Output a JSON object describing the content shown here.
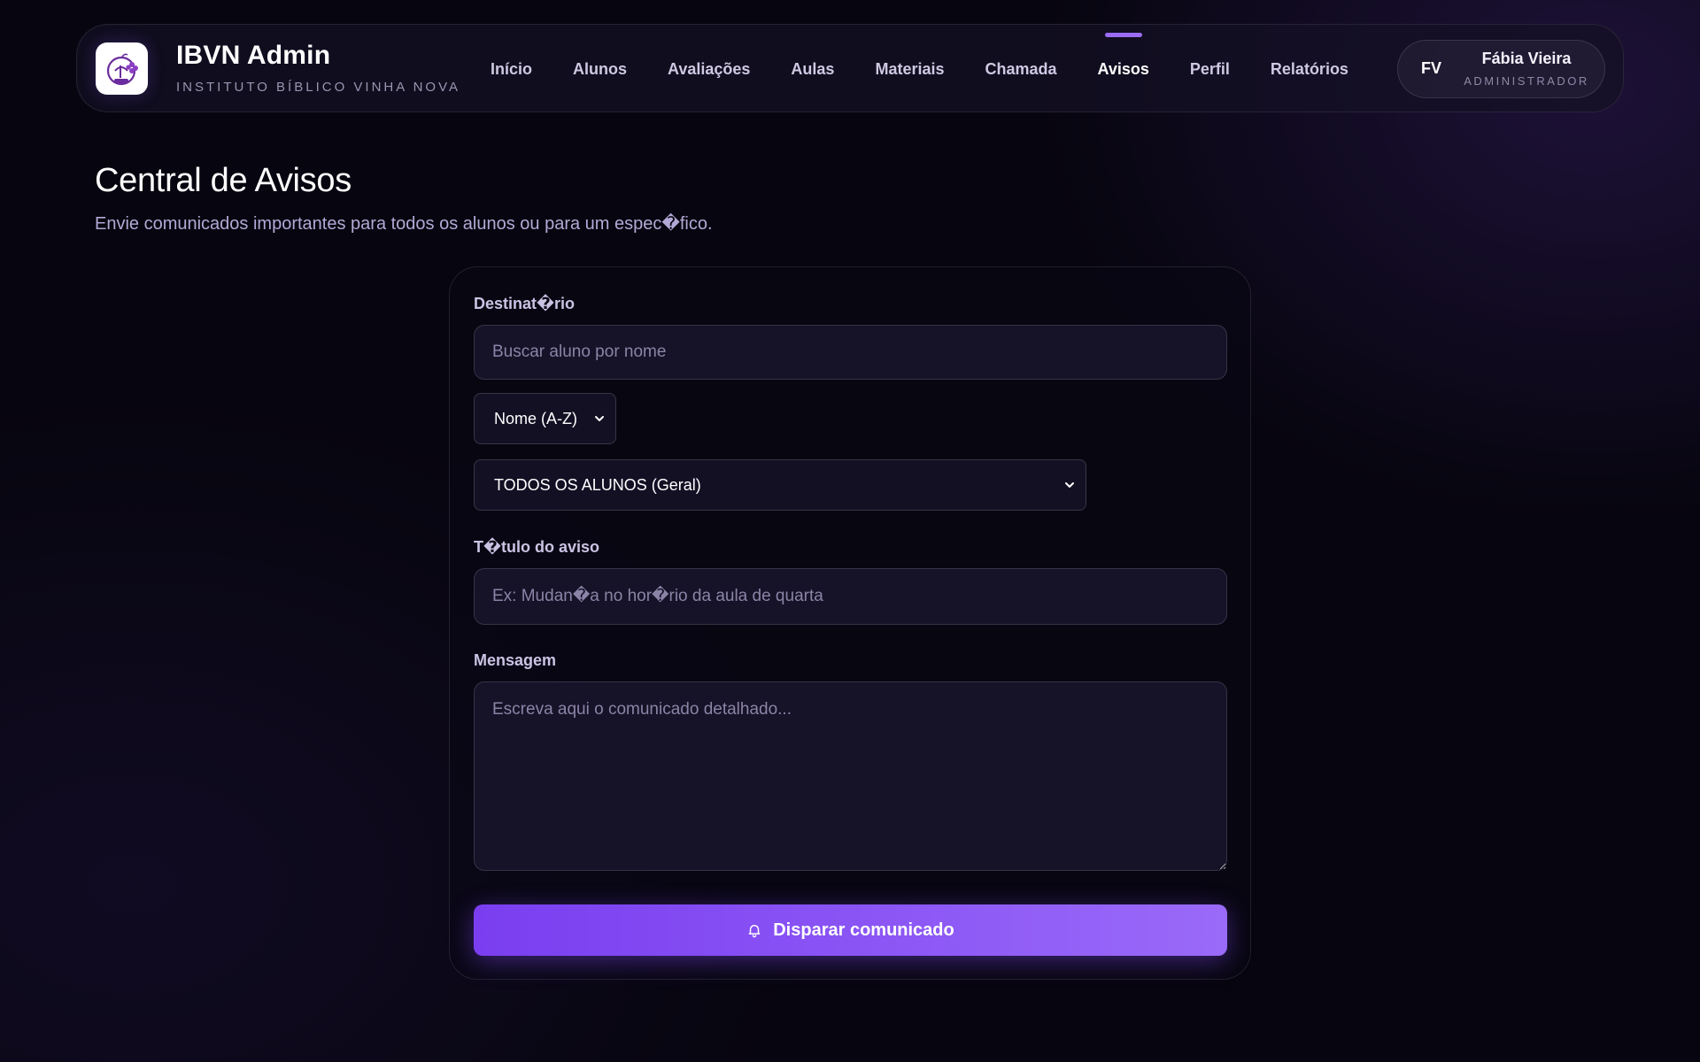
{
  "header": {
    "brand_title": "IBVN Admin",
    "brand_subtitle": "INSTITUTO BÍBLICO VINHA NOVA",
    "logo_icon": "vine-logo-icon",
    "nav": [
      {
        "label": "Início",
        "active": false
      },
      {
        "label": "Alunos",
        "active": false
      },
      {
        "label": "Avaliações",
        "active": false
      },
      {
        "label": "Aulas",
        "active": false
      },
      {
        "label": "Materiais",
        "active": false
      },
      {
        "label": "Chamada",
        "active": false
      },
      {
        "label": "Avisos",
        "active": true
      },
      {
        "label": "Perfil",
        "active": false
      },
      {
        "label": "Relatórios",
        "active": false
      }
    ],
    "user": {
      "initials": "FV",
      "name": "Fábia Vieira",
      "role": "ADMINISTRADOR"
    }
  },
  "page": {
    "title": "Central de Avisos",
    "description": "Envie comunicados importantes para todos os alunos ou para um espec�fico."
  },
  "form": {
    "recipient_label": "Destinat�rio",
    "search_placeholder": "Buscar aluno por nome",
    "sort_select": "Nome (A-Z)",
    "recipient_select": "TODOS OS ALUNOS (Geral)",
    "title_label": "T�tulo do aviso",
    "title_placeholder": "Ex: Mudan�a no hor�rio da aula de quarta",
    "message_label": "Mensagem",
    "message_placeholder": "Escreva aqui o comunicado detalhado...",
    "submit_label": "Disparar comunicado",
    "submit_icon": "bell-icon"
  },
  "colors": {
    "accent": "#9b6cf5",
    "button_start": "#7a3ef0",
    "button_end": "#9a6af9",
    "background": "#07050f"
  }
}
